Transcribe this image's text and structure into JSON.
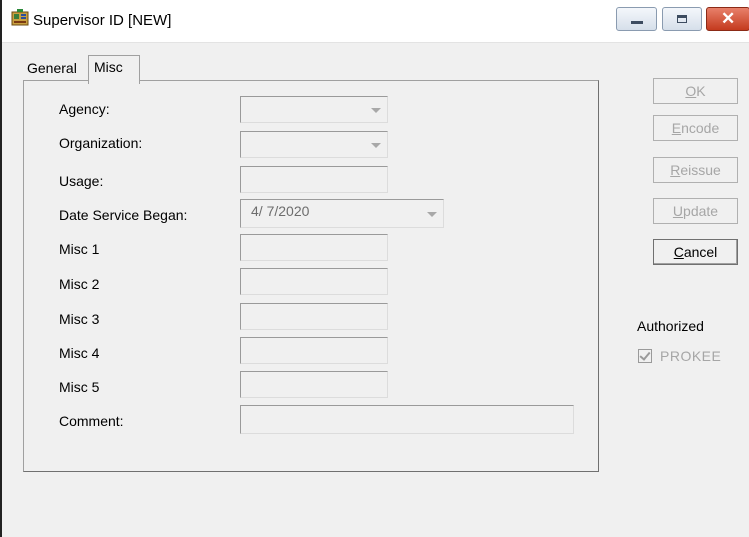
{
  "window": {
    "title": "Supervisor ID  [NEW]",
    "icon": "app-icon",
    "controls": {
      "minimize": "minimize-icon",
      "maximize": "maximize-icon",
      "close": "close-icon"
    }
  },
  "tabs": [
    {
      "label": "General",
      "active": false
    },
    {
      "label": "Misc",
      "active": true
    }
  ],
  "form": {
    "agency": {
      "label": "Agency:",
      "value": ""
    },
    "organization": {
      "label": "Organization:",
      "value": ""
    },
    "usage": {
      "label": "Usage:",
      "value": ""
    },
    "date_service_began": {
      "label": "Date Service Began:",
      "value": "4/  7/2020"
    },
    "misc1": {
      "label": "Misc 1",
      "value": ""
    },
    "misc2": {
      "label": "Misc 2",
      "value": ""
    },
    "misc3": {
      "label": "Misc 3",
      "value": ""
    },
    "misc4": {
      "label": "Misc 4",
      "value": ""
    },
    "misc5": {
      "label": "Misc 5",
      "value": ""
    },
    "comment": {
      "label": "Comment:",
      "value": ""
    }
  },
  "buttons": {
    "ok": {
      "mnemonic": "O",
      "rest": "K",
      "enabled": false
    },
    "encode": {
      "mnemonic": "E",
      "rest": "ncode",
      "enabled": false
    },
    "reissue": {
      "mnemonic": "R",
      "rest": "eissue",
      "enabled": false
    },
    "update": {
      "mnemonic": "U",
      "rest": "pdate",
      "enabled": false
    },
    "cancel": {
      "mnemonic": "C",
      "rest": "ancel",
      "enabled": true
    }
  },
  "authorized": {
    "label": "Authorized",
    "checkbox_label": "PROKEE",
    "checked": true
  },
  "colors": {
    "window_bg": "#f0f0f0",
    "close_button": "#c43a1e",
    "disabled_text": "#a6a6a6"
  }
}
